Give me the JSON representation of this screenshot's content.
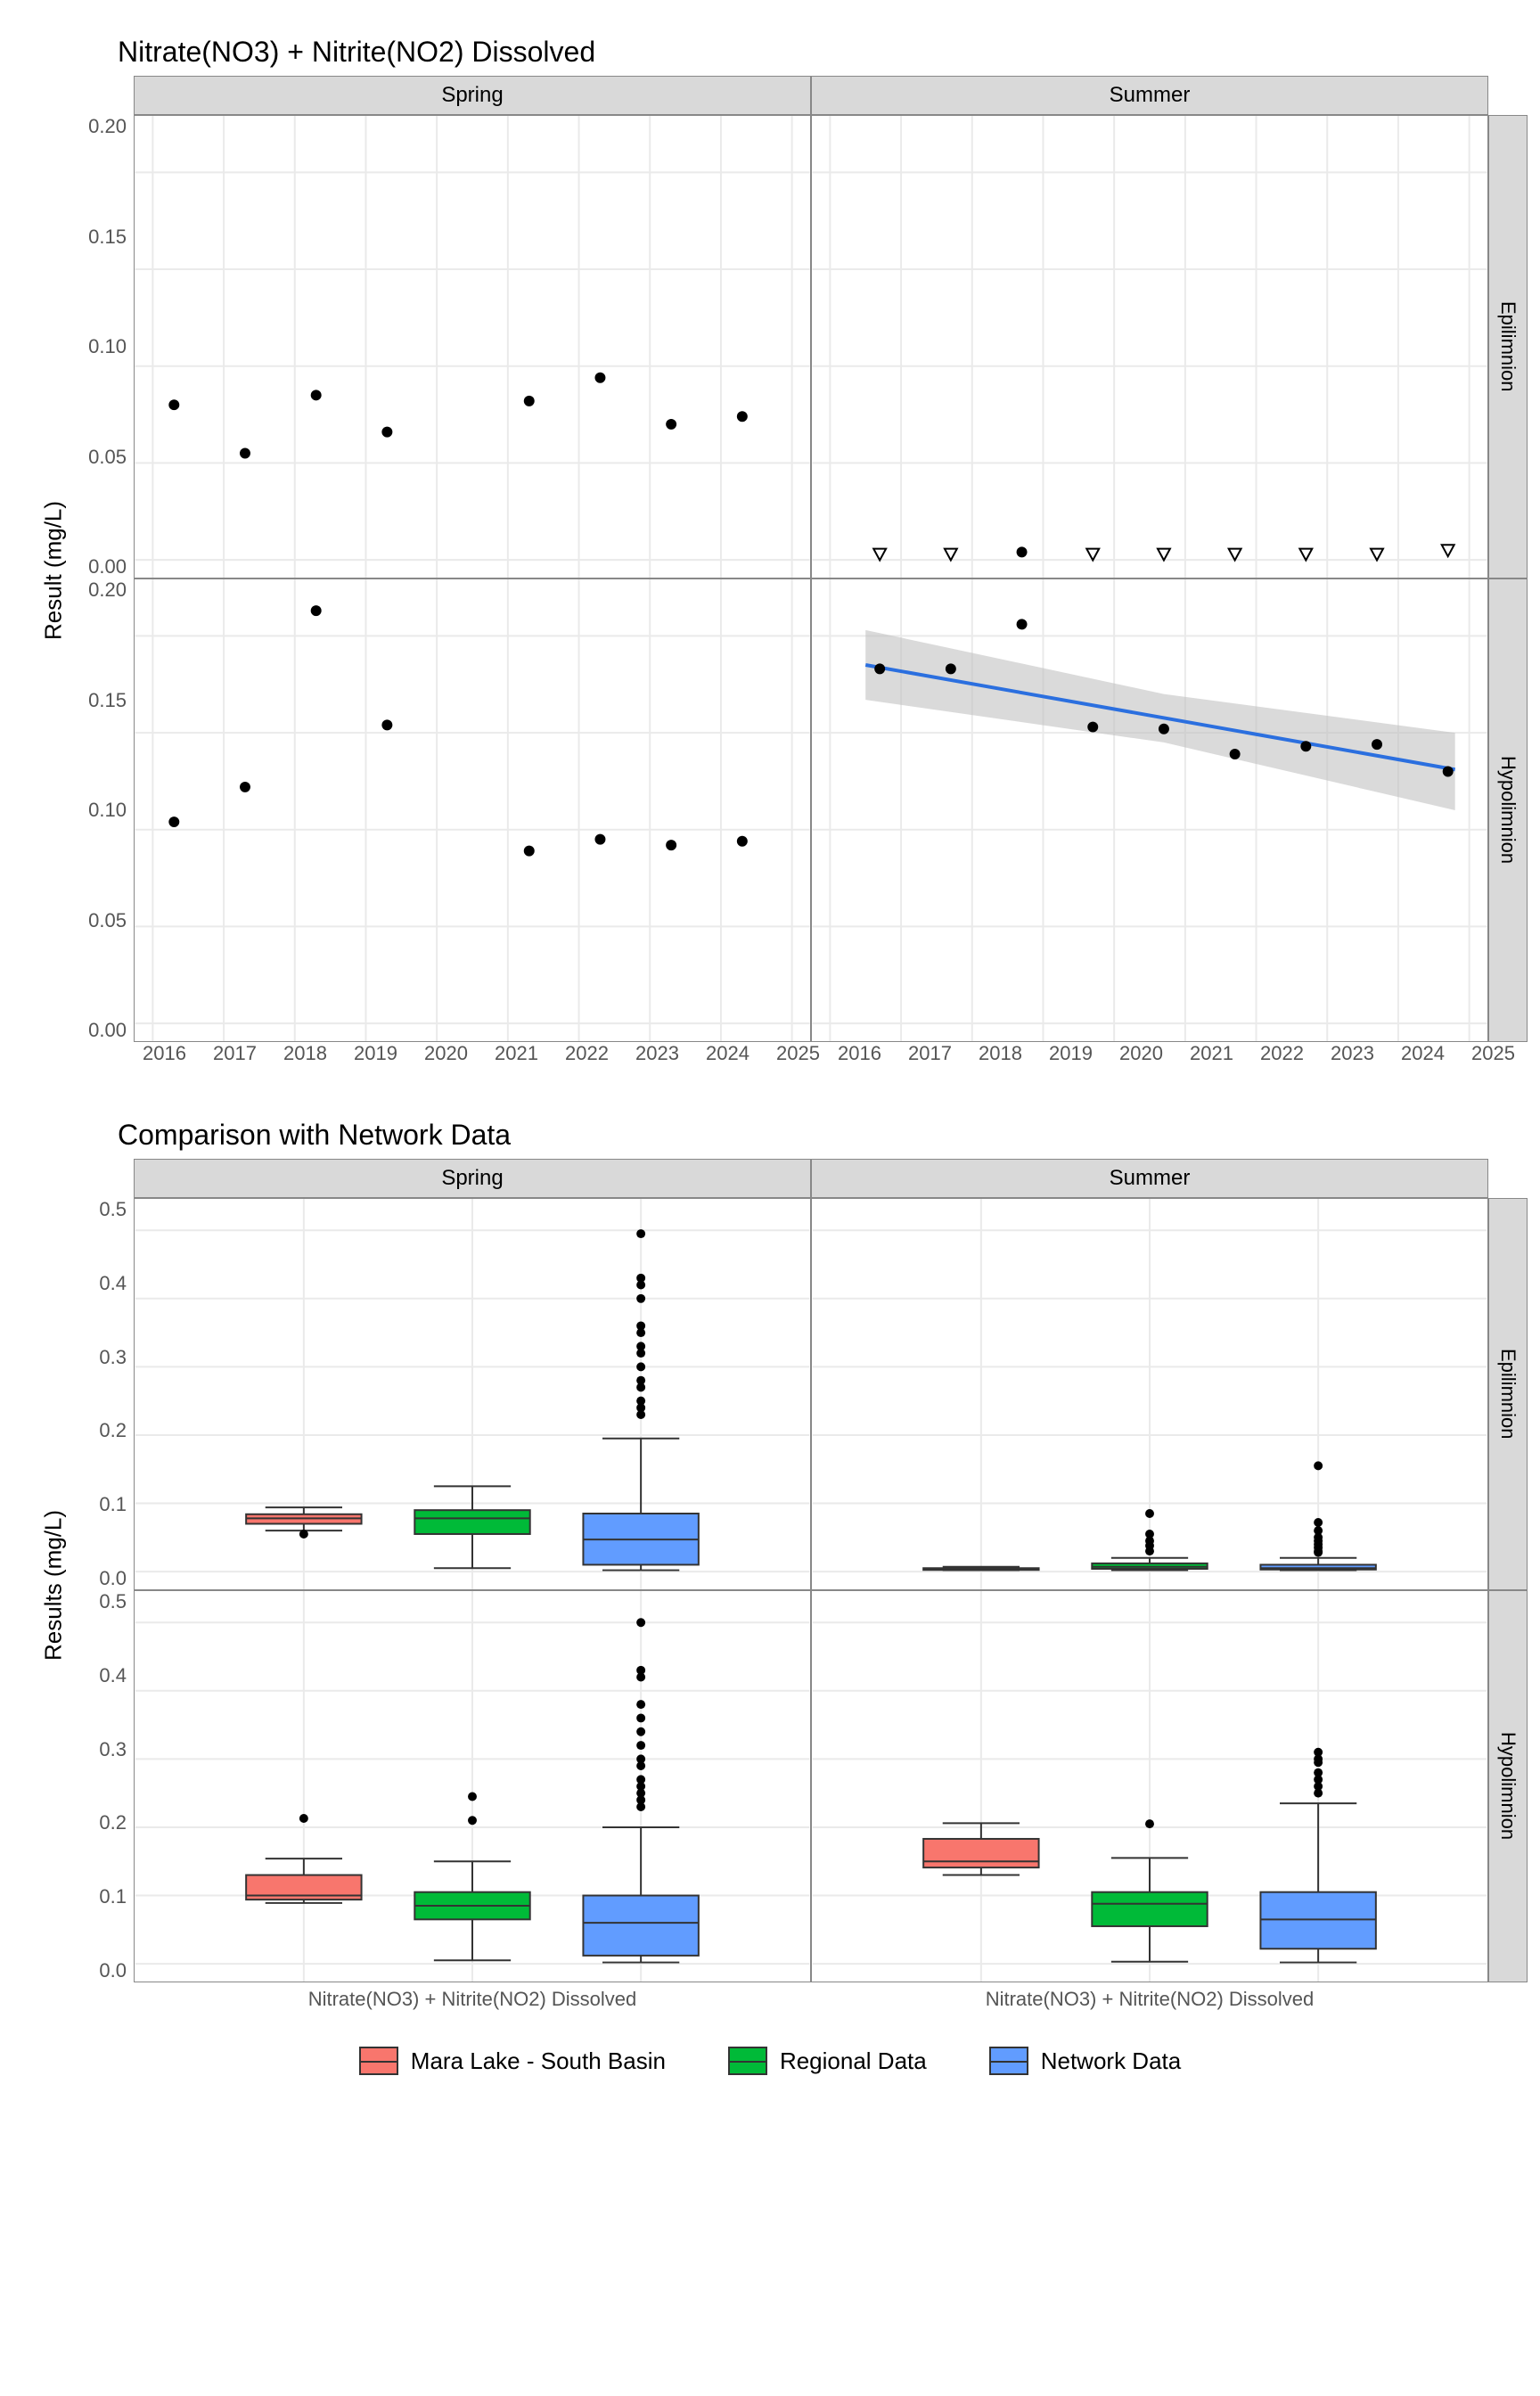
{
  "top_title": "Nitrate(NO3) + Nitrite(NO2) Dissolved",
  "bottom_title": "Comparison with Network Data",
  "ylabel_top": "Result (mg/L)",
  "ylabel_bottom": "Results (mg/L)",
  "col_facets": [
    "Spring",
    "Summer"
  ],
  "row_facets": [
    "Epilimnion",
    "Hypolimnion"
  ],
  "x_category": "Nitrate(NO3) + Nitrite(NO2) Dissolved",
  "legend": {
    "a": {
      "label": "Mara Lake - South Basin",
      "fill": "#f8766d"
    },
    "b": {
      "label": "Regional Data",
      "fill": "#00ba38"
    },
    "c": {
      "label": "Network Data",
      "fill": "#619cff"
    }
  },
  "chart_data": [
    {
      "id": "timeseries",
      "type": "scatter",
      "xlim": [
        2016,
        2025
      ],
      "ylim": [
        0,
        0.22
      ],
      "xticks": [
        2016,
        2017,
        2018,
        2019,
        2020,
        2021,
        2022,
        2023,
        2024,
        2025
      ],
      "yticks": [
        0.0,
        0.05,
        0.1,
        0.15,
        0.2
      ],
      "panels": {
        "Spring|Epilimnion": {
          "points": [
            {
              "x": 2016.3,
              "y": 0.08
            },
            {
              "x": 2017.3,
              "y": 0.055
            },
            {
              "x": 2018.3,
              "y": 0.085
            },
            {
              "x": 2019.3,
              "y": 0.066
            },
            {
              "x": 2021.3,
              "y": 0.082
            },
            {
              "x": 2022.3,
              "y": 0.094
            },
            {
              "x": 2023.3,
              "y": 0.07
            },
            {
              "x": 2024.3,
              "y": 0.074
            }
          ]
        },
        "Summer|Epilimnion": {
          "open_points": [
            {
              "x": 2016.7,
              "y": 0.003
            },
            {
              "x": 2017.7,
              "y": 0.003
            },
            {
              "x": 2019.7,
              "y": 0.003
            },
            {
              "x": 2020.7,
              "y": 0.003
            },
            {
              "x": 2021.7,
              "y": 0.003
            },
            {
              "x": 2022.7,
              "y": 0.003
            },
            {
              "x": 2023.7,
              "y": 0.003
            },
            {
              "x": 2024.7,
              "y": 0.005
            }
          ],
          "points": [
            {
              "x": 2018.7,
              "y": 0.004
            }
          ]
        },
        "Spring|Hypolimnion": {
          "points": [
            {
              "x": 2016.3,
              "y": 0.104
            },
            {
              "x": 2017.3,
              "y": 0.122
            },
            {
              "x": 2018.3,
              "y": 0.213
            },
            {
              "x": 2019.3,
              "y": 0.154
            },
            {
              "x": 2021.3,
              "y": 0.089
            },
            {
              "x": 2022.3,
              "y": 0.095
            },
            {
              "x": 2023.3,
              "y": 0.092
            },
            {
              "x": 2024.3,
              "y": 0.094
            }
          ]
        },
        "Summer|Hypolimnion": {
          "points": [
            {
              "x": 2016.7,
              "y": 0.183
            },
            {
              "x": 2017.7,
              "y": 0.183
            },
            {
              "x": 2018.7,
              "y": 0.206
            },
            {
              "x": 2019.7,
              "y": 0.153
            },
            {
              "x": 2020.7,
              "y": 0.152
            },
            {
              "x": 2021.7,
              "y": 0.139
            },
            {
              "x": 2022.7,
              "y": 0.143
            },
            {
              "x": 2023.7,
              "y": 0.144
            },
            {
              "x": 2024.7,
              "y": 0.13
            }
          ],
          "trend": {
            "x1": 2016.5,
            "y1": 0.185,
            "x2": 2024.8,
            "y2": 0.131
          },
          "ci": [
            {
              "x": 2016.5,
              "lo": 0.167,
              "hi": 0.203
            },
            {
              "x": 2020.7,
              "lo": 0.145,
              "hi": 0.17
            },
            {
              "x": 2024.8,
              "lo": 0.11,
              "hi": 0.15
            }
          ]
        }
      }
    },
    {
      "id": "boxplots",
      "type": "box",
      "ylim": [
        0,
        0.52
      ],
      "yticks": [
        0.0,
        0.1,
        0.2,
        0.3,
        0.4,
        0.5
      ],
      "panels": {
        "Spring|Epilimnion": {
          "boxes": [
            {
              "series": "a",
              "min": 0.06,
              "q1": 0.07,
              "med": 0.078,
              "q3": 0.084,
              "max": 0.094,
              "outliers": [
                0.055
              ]
            },
            {
              "series": "b",
              "min": 0.005,
              "q1": 0.055,
              "med": 0.078,
              "q3": 0.09,
              "max": 0.125,
              "outliers": []
            },
            {
              "series": "c",
              "min": 0.002,
              "q1": 0.01,
              "med": 0.047,
              "q3": 0.085,
              "max": 0.195,
              "outliers": [
                0.495,
                0.43,
                0.42,
                0.4,
                0.36,
                0.35,
                0.33,
                0.32,
                0.3,
                0.28,
                0.27,
                0.25,
                0.24,
                0.23
              ]
            }
          ]
        },
        "Summer|Epilimnion": {
          "boxes": [
            {
              "series": "a",
              "min": 0.002,
              "q1": 0.003,
              "med": 0.004,
              "q3": 0.005,
              "max": 0.007,
              "outliers": []
            },
            {
              "series": "b",
              "min": 0.002,
              "q1": 0.004,
              "med": 0.007,
              "q3": 0.012,
              "max": 0.02,
              "outliers": [
                0.085,
                0.055,
                0.045,
                0.038,
                0.03
              ]
            },
            {
              "series": "c",
              "min": 0.002,
              "q1": 0.003,
              "med": 0.005,
              "q3": 0.01,
              "max": 0.02,
              "outliers": [
                0.155,
                0.072,
                0.06,
                0.05,
                0.045,
                0.04,
                0.035,
                0.03,
                0.028
              ]
            }
          ]
        },
        "Spring|Hypolimnion": {
          "boxes": [
            {
              "series": "a",
              "min": 0.089,
              "q1": 0.094,
              "med": 0.1,
              "q3": 0.13,
              "max": 0.154,
              "outliers": [
                0.213
              ]
            },
            {
              "series": "b",
              "min": 0.005,
              "q1": 0.065,
              "med": 0.085,
              "q3": 0.105,
              "max": 0.15,
              "outliers": [
                0.245,
                0.21
              ]
            },
            {
              "series": "c",
              "min": 0.002,
              "q1": 0.012,
              "med": 0.06,
              "q3": 0.1,
              "max": 0.2,
              "outliers": [
                0.5,
                0.43,
                0.42,
                0.38,
                0.36,
                0.34,
                0.32,
                0.3,
                0.29,
                0.27,
                0.26,
                0.25,
                0.24,
                0.23
              ]
            }
          ]
        },
        "Summer|Hypolimnion": {
          "boxes": [
            {
              "series": "a",
              "min": 0.13,
              "q1": 0.141,
              "med": 0.15,
              "q3": 0.183,
              "max": 0.206,
              "outliers": []
            },
            {
              "series": "b",
              "min": 0.003,
              "q1": 0.055,
              "med": 0.088,
              "q3": 0.105,
              "max": 0.155,
              "outliers": [
                0.205
              ]
            },
            {
              "series": "c",
              "min": 0.002,
              "q1": 0.022,
              "med": 0.065,
              "q3": 0.105,
              "max": 0.235,
              "outliers": [
                0.31,
                0.3,
                0.295,
                0.28,
                0.27,
                0.26,
                0.25
              ]
            }
          ]
        }
      }
    }
  ]
}
